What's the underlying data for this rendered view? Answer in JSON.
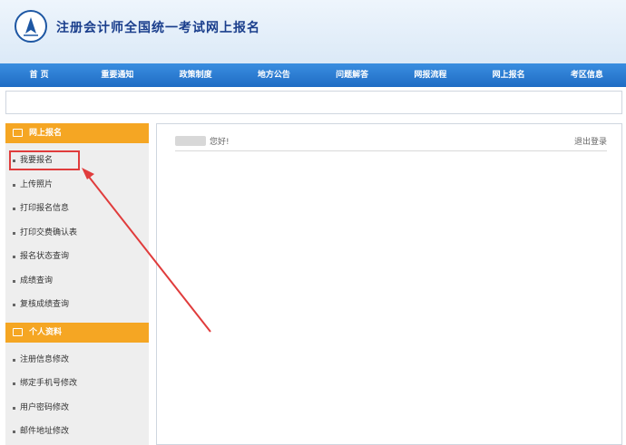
{
  "header": {
    "site_title": "注册会计师全国统一考试网上报名"
  },
  "nav": {
    "items": [
      "首 页",
      "重要通知",
      "政策制度",
      "地方公告",
      "问题解答",
      "网报流程",
      "网上报名",
      "考区信息"
    ]
  },
  "sidebar": {
    "section1": {
      "title": "网上报名",
      "items": [
        "我要报名",
        "上传照片",
        "打印报名信息",
        "打印交费确认表",
        "报名状态查询",
        "成绩查询",
        "复核成绩查询"
      ]
    },
    "section2": {
      "title": "个人资料",
      "items": [
        "注册信息修改",
        "绑定手机号修改",
        "用户密码修改",
        "邮件地址修改"
      ]
    }
  },
  "content": {
    "greeting": "您好!",
    "logout": "退出登录"
  },
  "colors": {
    "nav": "#1f6cc4",
    "sidebar_head": "#f5a623",
    "highlight": "#e03c3c",
    "title": "#1a3e8c"
  }
}
